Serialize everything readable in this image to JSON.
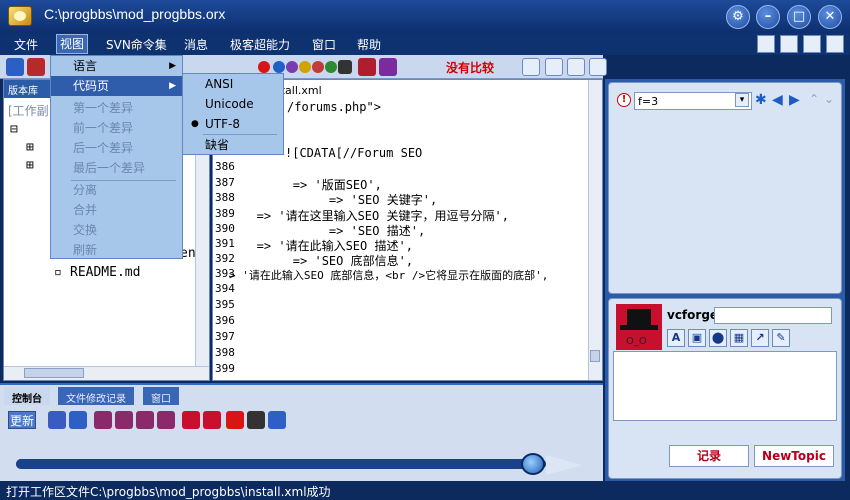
{
  "window": {
    "title": "C:\\progbbs\\mod_progbbs.orx"
  },
  "menubar": {
    "items": [
      "文件",
      "视图",
      "SVN命令集",
      "消息",
      "极客超能力",
      "窗口",
      "帮助"
    ]
  },
  "view_menu": {
    "items": [
      {
        "label": "语言",
        "state": "submenu"
      },
      {
        "label": "代码页",
        "state": "active"
      },
      {
        "label": "第一个差异",
        "state": "disabled"
      },
      {
        "label": "前一个差异",
        "state": "disabled"
      },
      {
        "label": "后一个差异",
        "state": "disabled"
      },
      {
        "label": "最后一个差异",
        "state": "disabled"
      },
      {
        "label": "分离",
        "state": "disabled"
      },
      {
        "label": "合并",
        "state": "disabled"
      },
      {
        "label": "交换",
        "state": "disabled"
      },
      {
        "label": "刷新",
        "state": "disabled"
      }
    ]
  },
  "codepage_menu": {
    "items": [
      "ANSI",
      "Unicode",
      "UTF-8",
      "缺省"
    ],
    "selected": "UTF-8"
  },
  "toolbar": {
    "no_compare": "没有比较"
  },
  "left_pane": {
    "tab": "版本库",
    "workdir": "[工作副",
    "tree_items": [
      "README.md"
    ],
    "partial_text": "en"
  },
  "editor": {
    "tab": "stall.xml",
    "code_fragments": [
      "/forums.php\">",
      "![CDATA[//Forum SEO"
    ],
    "lines": [
      {
        "no": "386",
        "text": ""
      },
      {
        "no": "387",
        "text": "        => '版面SEO',"
      },
      {
        "no": "388",
        "text": "             => 'SEO 关键字',"
      },
      {
        "no": "389",
        "text": "   => '请在这里输入SEO 关键字，用逗号分隔',"
      },
      {
        "no": "390",
        "text": "             => 'SEO 描述',"
      },
      {
        "no": "391",
        "text": "   => '请在此输入SEO 描述',"
      },
      {
        "no": "392",
        "text": "        => 'SEO 底部信息',"
      },
      {
        "no": "393",
        "text": "> '请在此输入SEO 底部信息，<br />它将显示在版面的底部',"
      },
      {
        "no": "394",
        "text": ""
      },
      {
        "no": "395",
        "text": ""
      },
      {
        "no": "396",
        "text": ""
      },
      {
        "no": "397",
        "text": ""
      },
      {
        "no": "398",
        "text": ""
      },
      {
        "no": "399",
        "text": ""
      }
    ]
  },
  "bottom_panel": {
    "tabs": [
      "控制台",
      "文件修改记录",
      "窗口"
    ],
    "refresh_label": "更新",
    "progress_fraction": 0.98
  },
  "right_panel": {
    "search_value": "f=3",
    "username": "vcforge",
    "avatar_text": "O_O",
    "record_button": "记录",
    "newtopic_button": "NewTopic",
    "format_icons": [
      "A",
      "▣",
      "⬤",
      "▦",
      "↗",
      "✎"
    ]
  },
  "statusbar": {
    "text": "打开工作区文件C:\\progbbs\\mod_progbbs\\install.xml成功"
  },
  "colors": {
    "accent": "#2f5dab",
    "alert": "#d40000",
    "window": "#0c2a5e"
  }
}
